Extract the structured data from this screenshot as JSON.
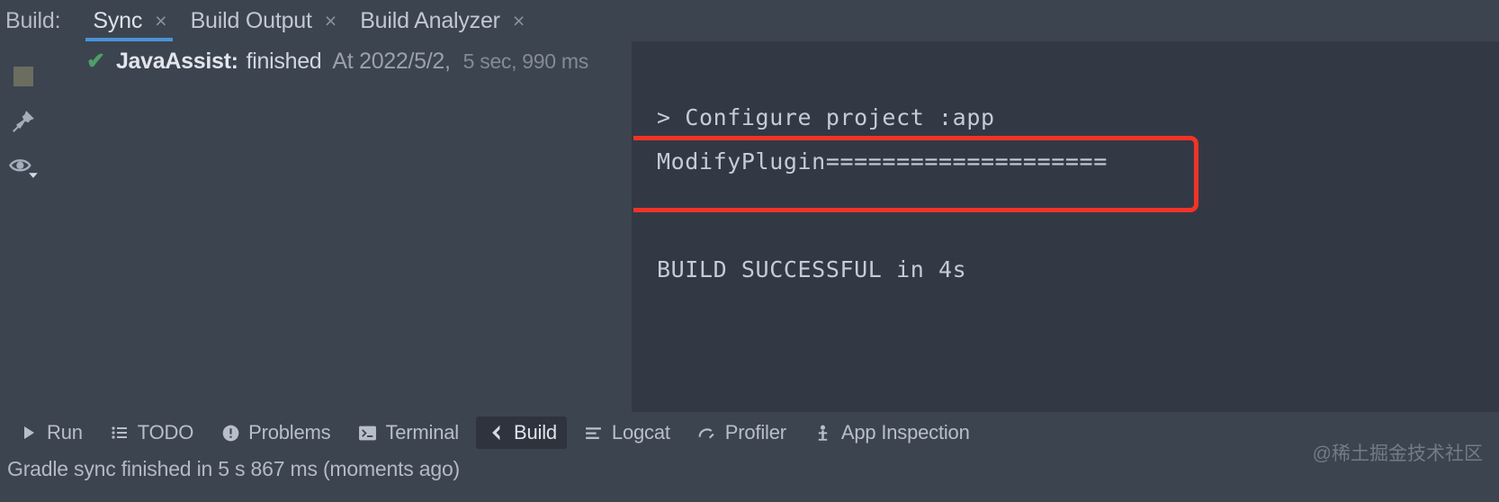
{
  "tabbar": {
    "label": "Build:",
    "tabs": [
      {
        "name": "Sync",
        "close": "×",
        "active": true
      },
      {
        "name": "Build Output",
        "close": "×",
        "active": false
      },
      {
        "name": "Build Analyzer",
        "close": "×",
        "active": false
      }
    ]
  },
  "gutter": {
    "items": [
      {
        "icon": "stop-square-icon",
        "label": "Stop"
      },
      {
        "icon": "pin-icon",
        "label": "Pin Tab"
      },
      {
        "icon": "eye-icon",
        "label": "Show Settings"
      }
    ]
  },
  "sync_tree": {
    "check": "✔",
    "title": "JavaAssist:",
    "state": "finished",
    "at": "At 2022/5/2,",
    "duration": "5 sec, 990 ms"
  },
  "console": {
    "configure_line": "> Configure project :app",
    "modify_line": "ModifyPlugin====================",
    "build_line": "BUILD SUCCESSFUL in 4s",
    "annotation_color": "#f23326"
  },
  "toolbar": {
    "buttons": [
      {
        "label": "Run",
        "icon": "play-icon",
        "active": false
      },
      {
        "label": "TODO",
        "icon": "list-icon",
        "active": false
      },
      {
        "label": "Problems",
        "icon": "warning-circle-icon",
        "active": false
      },
      {
        "label": "Terminal",
        "icon": "terminal-icon",
        "active": false
      },
      {
        "label": "Build",
        "icon": "hammer-icon",
        "active": true
      },
      {
        "label": "Logcat",
        "icon": "logcat-lines-icon",
        "active": false
      },
      {
        "label": "Profiler",
        "icon": "profiler-gauge-icon",
        "active": false
      },
      {
        "label": "App Inspection",
        "icon": "app-inspection-icon",
        "active": false
      }
    ]
  },
  "statusbar": {
    "message": "Gradle sync finished in 5 s 867 ms (moments ago)",
    "watermark": "@稀土掘金技术社区"
  }
}
